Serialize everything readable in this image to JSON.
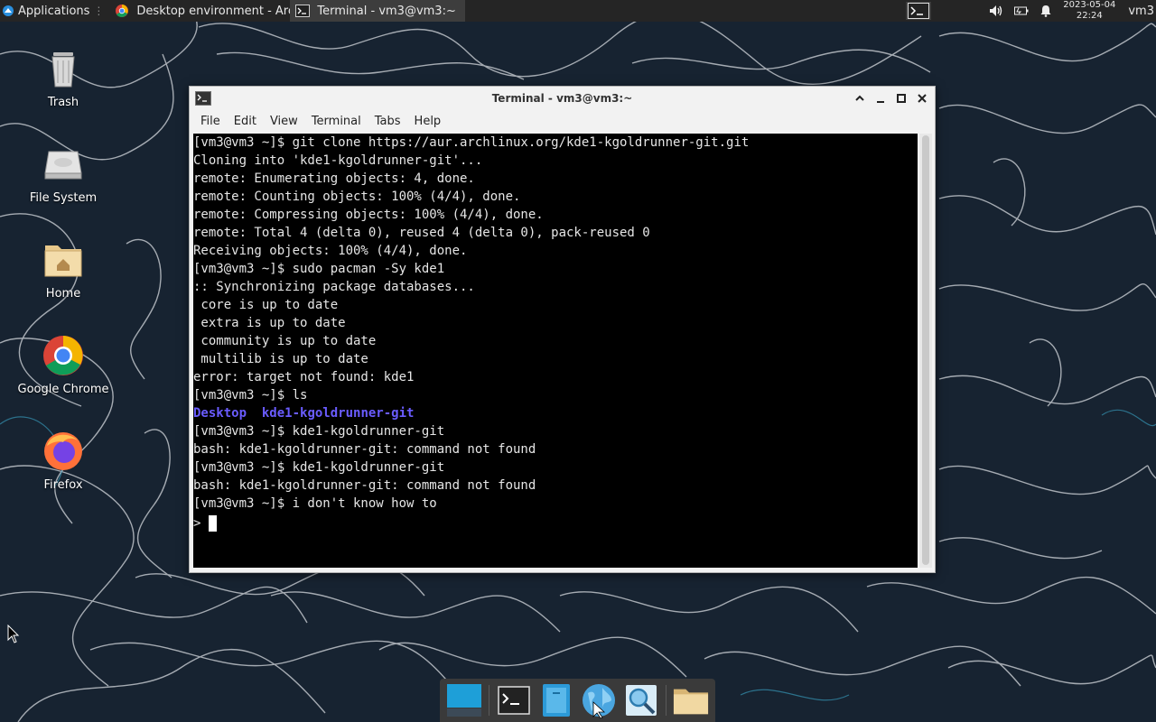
{
  "top_panel": {
    "applications_label": "Applications",
    "tasks": [
      {
        "label": "Desktop environment - Arc..."
      },
      {
        "label": "Terminal - vm3@vm3:~"
      }
    ],
    "clock_date": "2023-05-04",
    "clock_time": "22:24",
    "user": "vm3"
  },
  "desktop_icons": [
    {
      "label": "Trash",
      "icon": "trash-icon"
    },
    {
      "label": "File System",
      "icon": "drive-icon"
    },
    {
      "label": "Home",
      "icon": "home-folder-icon"
    },
    {
      "label": "Google Chrome",
      "icon": "chrome-icon"
    },
    {
      "label": "Firefox",
      "icon": "firefox-icon"
    }
  ],
  "terminal": {
    "title": "Terminal - vm3@vm3:~",
    "menu": [
      "File",
      "Edit",
      "View",
      "Terminal",
      "Tabs",
      "Help"
    ],
    "lines": [
      "[vm3@vm3 ~]$ git clone https://aur.archlinux.org/kde1-kgoldrunner-git.git",
      "Cloning into 'kde1-kgoldrunner-git'...",
      "remote: Enumerating objects: 4, done.",
      "remote: Counting objects: 100% (4/4), done.",
      "remote: Compressing objects: 100% (4/4), done.",
      "remote: Total 4 (delta 0), reused 4 (delta 0), pack-reused 0",
      "Receiving objects: 100% (4/4), done.",
      "[vm3@vm3 ~]$ sudo pacman -Sy kde1",
      ":: Synchronizing package databases...",
      " core is up to date",
      " extra is up to date",
      " community is up to date",
      " multilib is up to date",
      "error: target not found: kde1",
      "[vm3@vm3 ~]$ ls"
    ],
    "ls_output": [
      "Desktop",
      "kde1-kgoldrunner-git"
    ],
    "lines_after": [
      "[vm3@vm3 ~]$ kde1-kgoldrunner-git",
      "bash: kde1-kgoldrunner-git: command not found",
      "[vm3@vm3 ~]$ kde1-kgoldrunner-git",
      "bash: kde1-kgoldrunner-git: command not found",
      "[vm3@vm3 ~]$ i don't know how to"
    ],
    "prompt_continuation": "> "
  },
  "dock": {
    "items": [
      "show-desktop-icon",
      "terminal-icon",
      "file-manager-icon",
      "web-browser-icon",
      "app-finder-icon",
      "folder-icon"
    ]
  }
}
